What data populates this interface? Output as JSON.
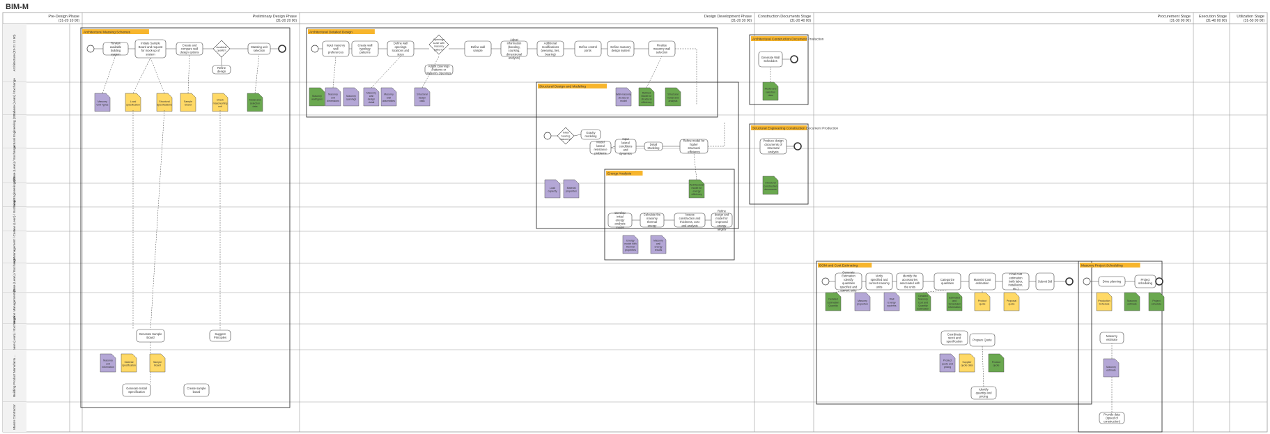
{
  "title": "BIM-M",
  "colors": {
    "grid": "#9a9a9a",
    "group_label_bg": "#f7b52c",
    "doc_green": "#6aa84f",
    "doc_lavender": "#b4a7d6",
    "doc_yellow": "#ffd966"
  },
  "phases": [
    {
      "name": "Pre-Design Phase",
      "code": "(31-20 10 00)"
    },
    {
      "name": "Preliminary Design Phase",
      "code": "(31-20 20 00)"
    },
    {
      "name": "Design Development Phase",
      "code": "(31-20 30 00)"
    },
    {
      "name": "Construction Documents Stage",
      "code": "(31-20 40 00)"
    },
    {
      "name": "Procurement Stage",
      "code": "(31-30 00 00)"
    },
    {
      "name": "Execution Stage",
      "code": "(31-40 00 00)"
    },
    {
      "name": "Utilization Stage",
      "code": "(31-50 00 00)"
    }
  ],
  "lanes": [
    "Architecture (33-21 11 00)",
    "Database (Lean) / Exchange",
    "Structural Engineering (33-21 31 14)",
    "Database (Lean) / Exchange",
    "Mechanical Engineering (33-21 31 17)",
    "Database (Lean) / Exchange",
    "Project Management / Cost Estimation (33-25 11 00)",
    "Database (Lean) / Exchange",
    "Construction Management (33-25 41 11)",
    "Database (Lean) / Exchange",
    "Building Product Manufacturing (33-41 61 11)",
    "Mason Contractor"
  ],
  "groups": [
    "Architectural Massing Schemes",
    "Architectural Detailed Design",
    "Structural Design and Modeling",
    "Architectural Construction Document Production",
    "Structural Engineering Construction Document Production",
    "Energy Analysis",
    "BOM and Cost Estimating",
    "Masonry Project Scheduling"
  ],
  "tasks": [
    "Review available building system",
    "Initiate Sample Board and request for mock-up of system",
    "Create and compare wall design options",
    "Available quality?",
    "Refine design",
    "Massing unit selection",
    "Input masonry wall preferences",
    "Create wall typology patterns",
    "Define wall openings locations and sizes",
    "Openings scale with masonry pattern?",
    "Adjust Openings Patterns or Masonry Openings",
    "Define wall sample",
    "Adjust information (bonding, coursing, dimensional analysis)",
    "Additional modifications (weeping, ties, bearing)",
    "Define control joints",
    "Define masonry design system",
    "Finalize masonry wall selection",
    "Generate Wall Schedules",
    "Initial bearing masonry?",
    "Gravity modeling",
    "Model lateral resistance problems",
    "Input lateral conditions and dynamics",
    "Detail Modeling",
    "Refine model for higher structural efficiency",
    "Produce design documents of structural analysis",
    "Develop initial energy analysis model",
    "Calculate the masonry thermal energy",
    "Assess construction and thickness, cost and analysis",
    "Refine design and model for improved energy targets",
    "Generate Estimation Identify quantities specified and current units",
    "Verify specified and current masonry units",
    "Identify the accessories associated with the units",
    "Categorize quantities",
    "Material Cost estimation",
    "Final cost estimation (with labor, installation, etc.)",
    "Submit Bid",
    "Generate Sample Board",
    "Suggest Principles",
    "Coordinate stock and specification",
    "Create sample board",
    "Generate Install Specification",
    "Prepare Quote",
    "Identify quantity and pricing",
    "Drive planning",
    "Project scheduling",
    "Provide data (speed of construction)"
  ],
  "documents": [
    "Masonry Unit Types",
    "Local specification",
    "Structural Specifications",
    "Sample Board",
    "Check masonry/ring unit",
    "Model and selection data",
    "Masonry wall types",
    "Masonry unit dimensions",
    "Masonry openings",
    "Masonry wall design detail",
    "Masonry wall assemblies",
    "Structural design data",
    "Wall-masonry structural model",
    "Refined Model for structural efficiency",
    "Structural model and analysis",
    "Load capacity",
    "Material properties",
    "Architectural model for energy efficiency",
    "Structural construction documents",
    "Energy model with thermal properties",
    "Masonry wall energy results",
    "Detailed Estimation Quantity",
    "Masonry properties",
    "Wall Energy systems",
    "Detailed Masonry Cost and Quantity Estimation",
    "Estimated and Scheduled information",
    "Product quote",
    "Proposal quote",
    "Production Schedule",
    "Masonry estimate",
    "Project schedule",
    "Masonry unit information",
    "Material specification",
    "Product quote and pricing",
    "Supplier quote data"
  ]
}
